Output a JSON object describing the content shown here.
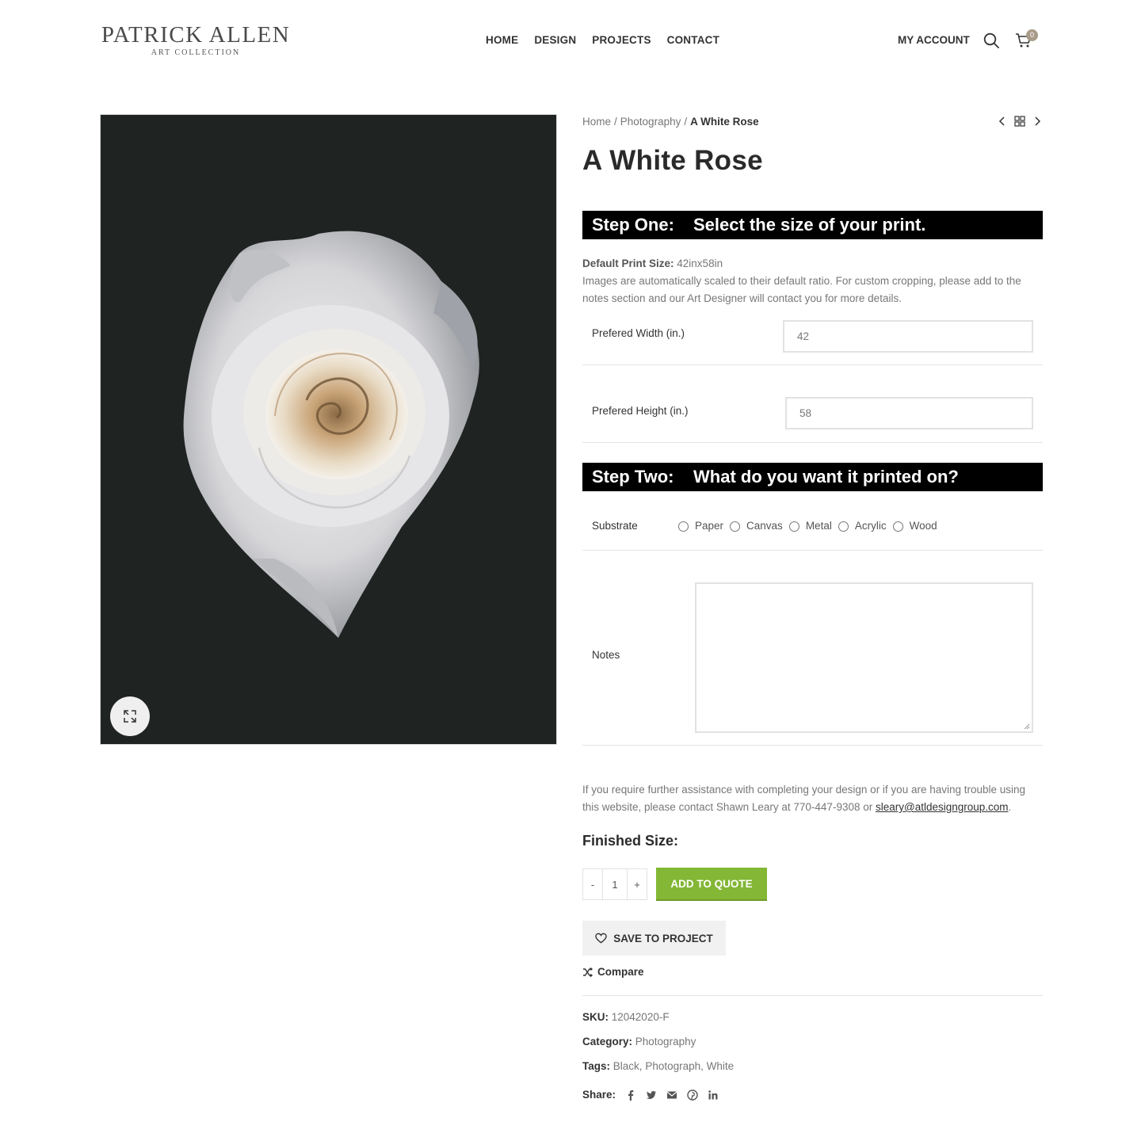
{
  "header": {
    "logo_main": "PATRICK ALLEN",
    "logo_sub": "ART COLLECTION",
    "nav": [
      "HOME",
      "DESIGN",
      "PROJECTS",
      "CONTACT"
    ],
    "account": "MY ACCOUNT",
    "cart_count": "0"
  },
  "breadcrumb": {
    "home": "Home",
    "sep": "/",
    "category": "Photography",
    "current": "A White Rose"
  },
  "product": {
    "title": "A White Rose",
    "image_icon": "white-rose-photo"
  },
  "step_one": {
    "label": "Step One:",
    "text": "Select the size of your print."
  },
  "info": {
    "default_label": "Default Print Size:",
    "default_value": "42inx58in",
    "description": "Images are automatically scaled to their default ratio. For custom cropping, please add to the notes section and our Art Designer will contact you for more details."
  },
  "fields": {
    "width_label": "Prefered Width (in.)",
    "width_value": "42",
    "height_label": "Prefered Height (in.)",
    "height_value": "58"
  },
  "step_two": {
    "label": "Step Two:",
    "text": "What do you want it printed on?"
  },
  "substrate": {
    "label": "Substrate",
    "options": [
      "Paper",
      "Canvas",
      "Metal",
      "Acrylic",
      "Wood"
    ]
  },
  "notes": {
    "label": "Notes"
  },
  "assist": {
    "text": "If you require further assistance with completing your design or if you are having trouble using this website, please contact Shawn Leary at 770-447-9308 or ",
    "email": "sleary@atldesigngroup.com",
    "end": "."
  },
  "finished_size": "Finished Size:",
  "quantity": {
    "minus": "-",
    "value": "1",
    "plus": "+"
  },
  "buttons": {
    "add_to_quote": "ADD TO QUOTE",
    "save_to_project": "SAVE TO PROJECT",
    "compare": "Compare"
  },
  "meta": {
    "sku_label": "SKU:",
    "sku": "12042020-F",
    "category_label": "Category:",
    "category": "Photography",
    "tags_label": "Tags:",
    "tags": [
      "Black",
      "Photograph",
      "White"
    ],
    "share_label": "Share:"
  },
  "colors": {
    "accent_green": "#83b735",
    "step_bar": "#000000",
    "cart_badge": "#a89a88"
  }
}
